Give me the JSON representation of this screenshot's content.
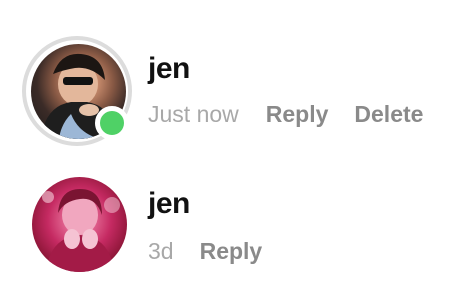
{
  "comments": [
    {
      "username": "jen",
      "timestamp": "Just now",
      "actions": [
        "Reply",
        "Delete"
      ],
      "has_story_ring": true,
      "online": true,
      "avatar_colors": [
        "#d9a98b",
        "#3b2b27"
      ],
      "online_color": "#4fd166"
    },
    {
      "username": "jen",
      "timestamp": "3d",
      "actions": [
        "Reply"
      ],
      "has_story_ring": false,
      "online": false,
      "avatar_colors": [
        "#e0628e",
        "#8e1638"
      ]
    }
  ]
}
